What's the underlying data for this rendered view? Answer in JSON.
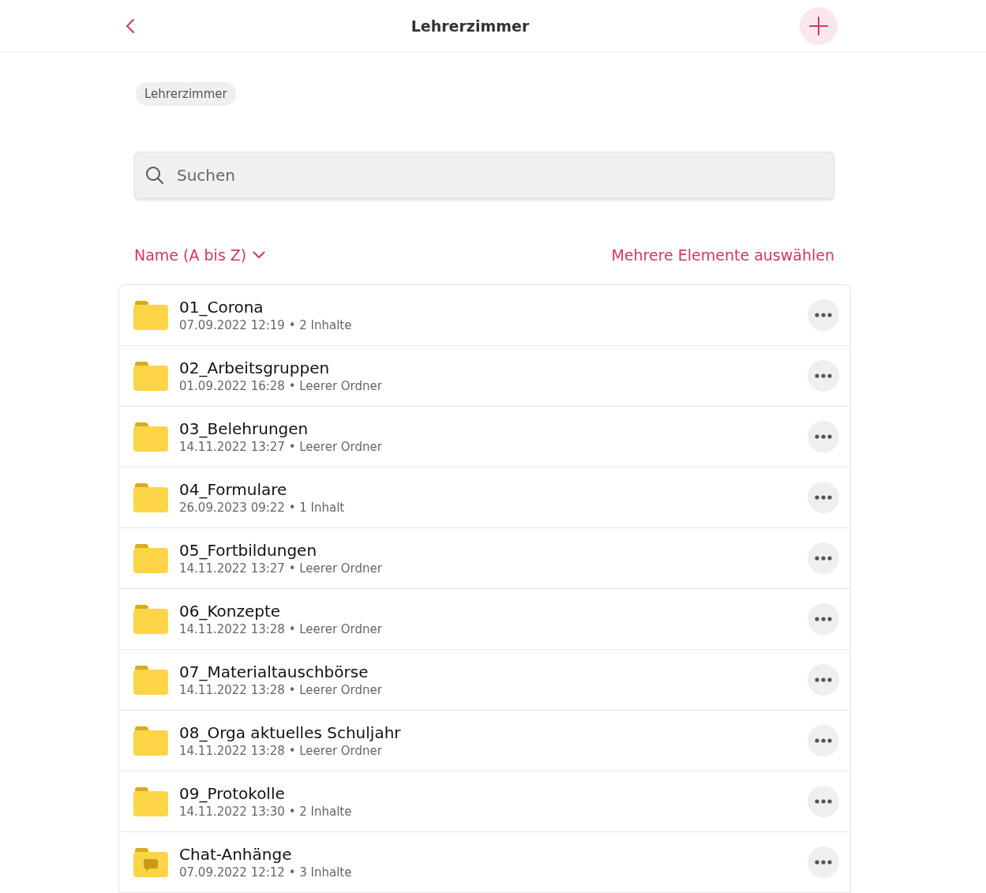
{
  "header": {
    "title": "Lehrerzimmer"
  },
  "breadcrumb": [
    "Lehrerzimmer"
  ],
  "search": {
    "placeholder": "Suchen"
  },
  "sort": {
    "label": "Name (A bis Z)"
  },
  "select_multiple": "Mehrere Elemente auswählen",
  "items": [
    {
      "kind": "folder",
      "name": "01_Corona",
      "meta": "07.09.2022 12:19 • 2 Inhalte"
    },
    {
      "kind": "folder",
      "name": "02_Arbeitsgruppen",
      "meta": "01.09.2022 16:28 • Leerer Ordner"
    },
    {
      "kind": "folder",
      "name": "03_Belehrungen",
      "meta": "14.11.2022 13:27 • Leerer Ordner"
    },
    {
      "kind": "folder",
      "name": "04_Formulare",
      "meta": "26.09.2023 09:22 • 1 Inhalt"
    },
    {
      "kind": "folder",
      "name": "05_Fortbildungen",
      "meta": "14.11.2022 13:27 • Leerer Ordner"
    },
    {
      "kind": "folder",
      "name": "06_Konzepte",
      "meta": "14.11.2022 13:28 • Leerer Ordner"
    },
    {
      "kind": "folder",
      "name": "07_Materialtauschbörse",
      "meta": "14.11.2022 13:28 • Leerer Ordner"
    },
    {
      "kind": "folder",
      "name": "08_Orga aktuelles Schuljahr",
      "meta": "14.11.2022 13:28 • Leerer Ordner"
    },
    {
      "kind": "folder",
      "name": "09_Protokolle",
      "meta": "14.11.2022 13:30 • 2 Inhalte"
    },
    {
      "kind": "chat",
      "name": "Chat-Anhänge",
      "meta": "07.09.2022 12:12 • 3 Inhalte"
    }
  ]
}
